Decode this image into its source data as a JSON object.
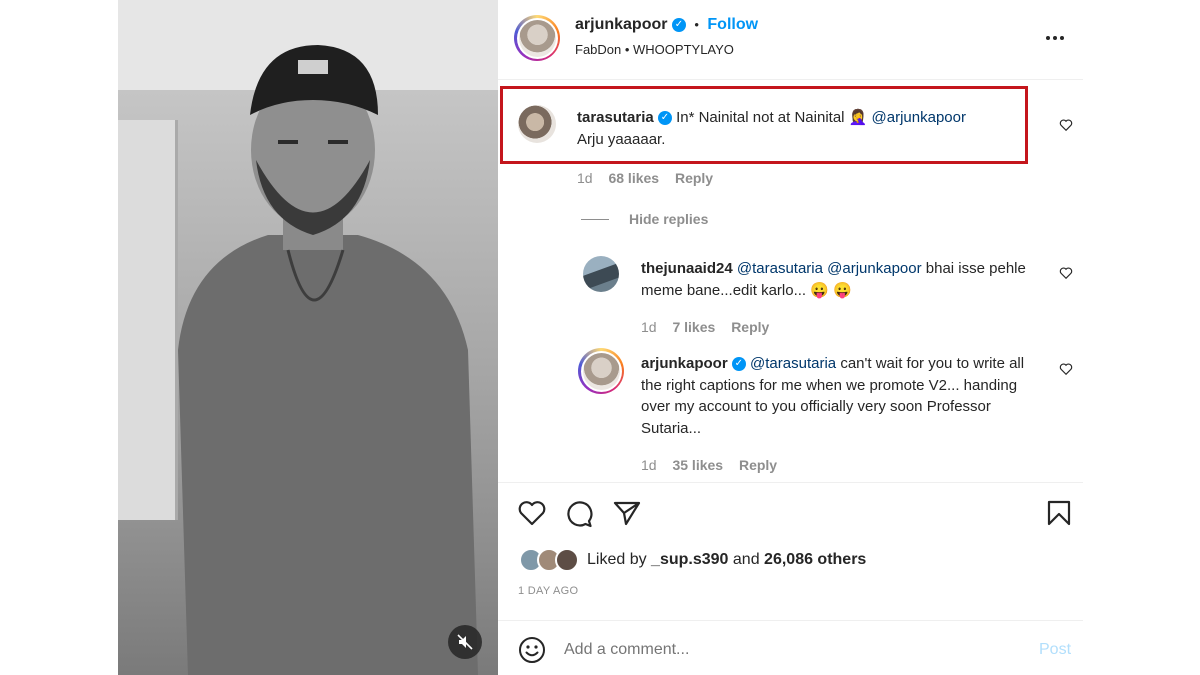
{
  "post_header": {
    "username": "arjunkapoor",
    "follow_label": "Follow",
    "dot": "•",
    "audio": "FabDon • WHOOPTYLAYO"
  },
  "highlighted_comment": {
    "username": "tarasutaria",
    "text_pre": "In* Nainital not at Nainital 🤦‍♀️",
    "mention": "@arjunkapoor",
    "text_line2": "Arju yaaaaar.",
    "time": "1d",
    "likes": "68 likes",
    "reply": "Reply"
  },
  "hide_replies": "Hide replies",
  "replies": [
    {
      "username": "thejunaaid24",
      "mention1": "@tarasutaria",
      "mention2": "@arjunkapoor",
      "text": "bhai isse pehle meme bane...edit karlo... 😛 😛",
      "time": "1d",
      "likes": "7 likes",
      "reply": "Reply"
    },
    {
      "username": "arjunkapoor",
      "mention1": "@tarasutaria",
      "text": "can't wait for you to write all the right captions for me when we promote V2... handing over my account to you officially very soon Professor Sutaria...",
      "time": "1d",
      "likes": "35 likes",
      "reply": "Reply"
    }
  ],
  "liked_by": {
    "prefix": "Liked by",
    "user": "_sup.s390",
    "and": "and",
    "others": "26,086 others"
  },
  "post_age": "1 DAY AGO",
  "comment_input": {
    "placeholder": "Add a comment...",
    "post_label": "Post"
  },
  "icons": {
    "more": "more-options-icon",
    "like": "heart-icon",
    "comment": "comment-icon",
    "share": "share-icon",
    "save": "bookmark-icon",
    "emoji": "emoji-icon",
    "mute": "muted-speaker-icon"
  },
  "colors": {
    "highlight_border": "#c4161c",
    "verified_blue": "#0095f6",
    "follow_blue": "#0095f6",
    "mention_blue": "#00376b",
    "muted_text": "#8e8e8e",
    "post_disabled": "#b2dffc"
  }
}
